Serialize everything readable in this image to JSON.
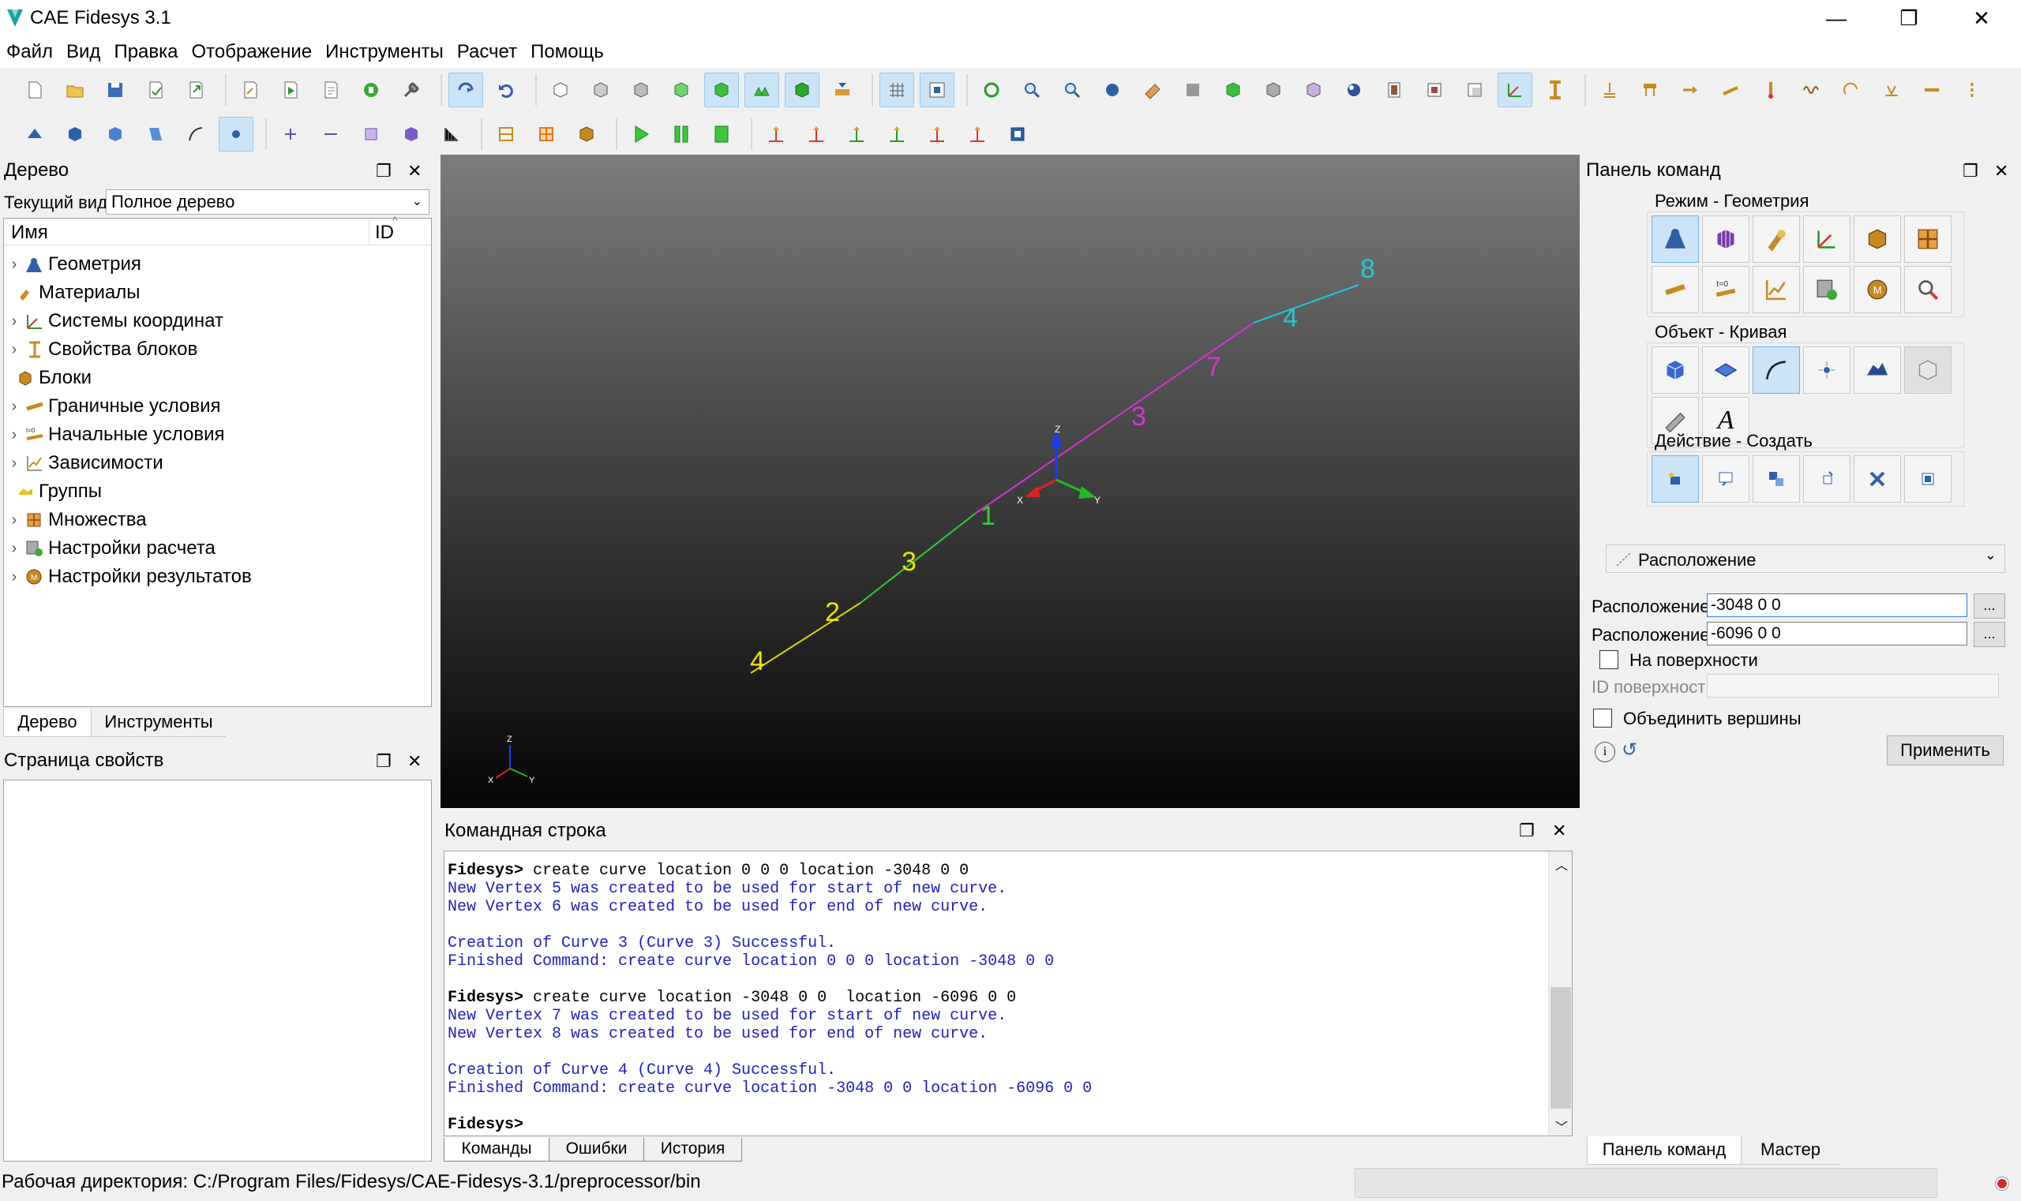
{
  "window": {
    "title": "CAE Fidesys 3.1",
    "minimize": "—",
    "maximize": "❐",
    "close": "✕"
  },
  "menu": [
    "Файл",
    "Вид",
    "Правка",
    "Отображение",
    "Инструменты",
    "Расчет",
    "Помощь"
  ],
  "tree_panel": {
    "title": "Дерево",
    "current_view_label": "Текущий вид",
    "current_view_value": "Полное дерево",
    "col_name": "Имя",
    "col_id": "ID",
    "items": [
      {
        "label": "Геометрия",
        "expandable": true,
        "icon": "geometry-icon"
      },
      {
        "label": "Материалы",
        "expandable": false,
        "icon": "materials-icon"
      },
      {
        "label": "Системы координат",
        "expandable": true,
        "icon": "coordinate-systems-icon"
      },
      {
        "label": "Свойства блоков",
        "expandable": true,
        "icon": "block-properties-icon"
      },
      {
        "label": "Блоки",
        "expandable": false,
        "icon": "blocks-icon"
      },
      {
        "label": "Граничные условия",
        "expandable": true,
        "icon": "boundary-conditions-icon"
      },
      {
        "label": "Начальные условия",
        "expandable": true,
        "icon": "initial-conditions-icon"
      },
      {
        "label": "Зависимости",
        "expandable": true,
        "icon": "dependencies-icon"
      },
      {
        "label": "Группы",
        "expandable": false,
        "icon": "groups-icon"
      },
      {
        "label": "Множества",
        "expandable": true,
        "icon": "sets-icon"
      },
      {
        "label": "Настройки расчета",
        "expandable": true,
        "icon": "calc-settings-icon"
      },
      {
        "label": "Настройки результатов",
        "expandable": true,
        "icon": "results-settings-icon"
      }
    ],
    "tabs": [
      "Дерево",
      "Инструменты"
    ]
  },
  "properties_panel": {
    "title": "Страница свойств"
  },
  "viewport": {
    "labels": [
      {
        "text": "4",
        "color": "#e6e600"
      },
      {
        "text": "2",
        "color": "#e6e600"
      },
      {
        "text": "3",
        "color": "#e6e600"
      },
      {
        "text": "1",
        "color": "#33cc33"
      },
      {
        "text": "3",
        "color": "#d633d6"
      },
      {
        "text": "7",
        "color": "#d633d6"
      },
      {
        "text": "4",
        "color": "#22c8d6"
      },
      {
        "text": "8",
        "color": "#22c8d6"
      }
    ],
    "axis_x": "X",
    "axis_y": "Y",
    "axis_z": "Z"
  },
  "command_line": {
    "title": "Командная строка",
    "lines": [
      {
        "type": "prompt",
        "prefix": "Fidesys>",
        "text": " create curve location 0 0 0 location -3048 0 0"
      },
      {
        "type": "out",
        "text": "New Vertex 5 was created to be used for start of new curve."
      },
      {
        "type": "out",
        "text": "New Vertex 6 was created to be used for end of new curve."
      },
      {
        "type": "blank",
        "text": ""
      },
      {
        "type": "out",
        "text": "Creation of Curve 3 (Curve 3) Successful."
      },
      {
        "type": "out",
        "text": "Finished Command: create curve location 0 0 0 location -3048 0 0"
      },
      {
        "type": "blank",
        "text": ""
      },
      {
        "type": "prompt",
        "prefix": "Fidesys>",
        "text": " create curve location -3048 0 0  location -6096 0 0"
      },
      {
        "type": "out",
        "text": "New Vertex 7 was created to be used for start of new curve."
      },
      {
        "type": "out",
        "text": "New Vertex 8 was created to be used for end of new curve."
      },
      {
        "type": "blank",
        "text": ""
      },
      {
        "type": "out",
        "text": "Creation of Curve 4 (Curve 4) Successful."
      },
      {
        "type": "out",
        "text": "Finished Command: create curve location -3048 0 0 location -6096 0 0"
      },
      {
        "type": "blank",
        "text": ""
      },
      {
        "type": "prompt",
        "prefix": "Fidesys>",
        "text": ""
      }
    ],
    "tabs": [
      "Команды",
      "Ошибки",
      "История"
    ]
  },
  "command_panel": {
    "title": "Панель команд",
    "mode_label": "Режим - Геометрия",
    "object_label": "Объект - Кривая",
    "action_label": "Действие - Создать",
    "method_select": "Расположение",
    "location1_label": "Расположение",
    "location1_value": "-3048 0 0",
    "location2_label": "Расположение",
    "location2_value": "-6096 0 0",
    "browse": "...",
    "on_surface_label": "На поверхности",
    "surface_id_label": "ID поверхности",
    "merge_vertices_label": "Объединить вершины",
    "apply_button": "Применить",
    "tabs": [
      "Панель команд",
      "Мастер"
    ]
  },
  "status": {
    "workdir": "Рабочая директория: C:/Program Files/Fidesys/CAE-Fidesys-3.1/preprocessor/bin"
  }
}
